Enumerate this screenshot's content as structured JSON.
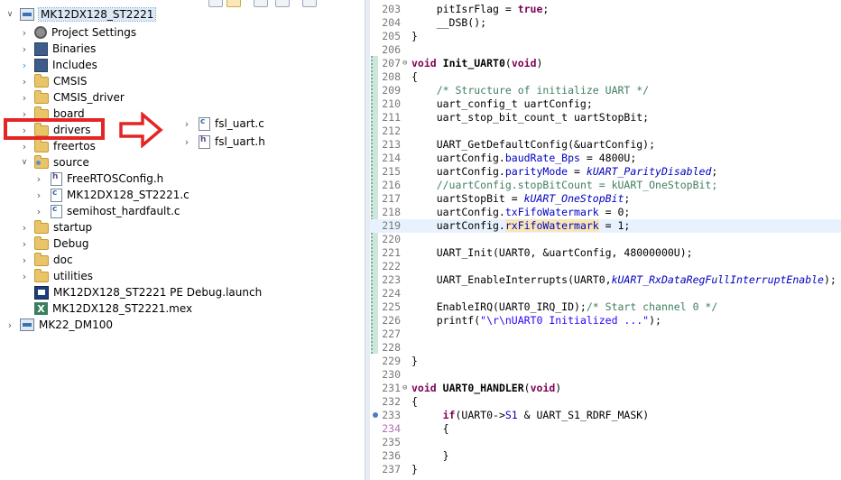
{
  "explorer": {
    "tree": [
      {
        "label": "MK12DX128_ST2221",
        "icon": "project-icon",
        "chevron": "down",
        "level": 0
      },
      {
        "label": "Project Settings",
        "icon": "gear-icon",
        "chevron": "right",
        "level": 1
      },
      {
        "label": "Binaries",
        "icon": "binaries-icon",
        "chevron": "right",
        "level": 1
      },
      {
        "label": "Includes",
        "icon": "includes-icon",
        "chevron": "right",
        "level": 1
      },
      {
        "label": "CMSIS",
        "icon": "folder-icon",
        "chevron": "right",
        "level": 1
      },
      {
        "label": "CMSIS_driver",
        "icon": "folder-icon",
        "chevron": "right",
        "level": 1
      },
      {
        "label": "board",
        "icon": "folder-icon",
        "chevron": "right",
        "level": 1
      },
      {
        "label": "drivers",
        "icon": "folder-icon",
        "chevron": "right",
        "level": 1
      },
      {
        "label": "freertos",
        "icon": "folder-icon",
        "chevron": "right",
        "level": 1
      },
      {
        "label": "source",
        "icon": "source-folder-icon",
        "chevron": "down",
        "level": 1
      },
      {
        "label": "FreeRTOSConfig.h",
        "icon": "header-file-icon",
        "chevron": "right",
        "level": 2
      },
      {
        "label": "MK12DX128_ST2221.c",
        "icon": "c-file-icon",
        "chevron": "right",
        "level": 2
      },
      {
        "label": "semihost_hardfault.c",
        "icon": "c-file-icon",
        "chevron": "right",
        "level": 2
      },
      {
        "label": "startup",
        "icon": "folder-icon",
        "chevron": "right",
        "level": 1
      },
      {
        "label": "Debug",
        "icon": "folder-icon",
        "chevron": "right",
        "level": 1
      },
      {
        "label": "doc",
        "icon": "folder-icon",
        "chevron": "right",
        "level": 1
      },
      {
        "label": "utilities",
        "icon": "folder-icon",
        "chevron": "right",
        "level": 1
      },
      {
        "label": "MK12DX128_ST2221 PE Debug.launch",
        "icon": "launch-icon",
        "chevron": "none",
        "level": 1
      },
      {
        "label": "MK12DX128_ST2221.mex",
        "icon": "mex-icon",
        "chevron": "none",
        "level": 1
      },
      {
        "label": "MK22_DM100",
        "icon": "project-icon",
        "chevron": "right",
        "level": 0
      }
    ],
    "overlay_files": [
      {
        "label": "fsl_uart.c",
        "icon": "c-file-icon"
      },
      {
        "label": "fsl_uart.h",
        "icon": "header-file-icon"
      }
    ],
    "mex_letter": "X",
    "h_letter": "h",
    "c_letter": "c"
  },
  "annotation": {
    "box_color": "#e52525",
    "arrow_color": "#e52525"
  },
  "editor": {
    "lines": [
      {
        "n": "203",
        "code": "    pitIsrFlag = true;"
      },
      {
        "n": "204",
        "code": "    __DSB();"
      },
      {
        "n": "205",
        "code": "}"
      },
      {
        "n": "206",
        "code": ""
      },
      {
        "n": "207",
        "code": "void Init_UART0(void)",
        "fold": true
      },
      {
        "n": "208",
        "code": "{"
      },
      {
        "n": "209",
        "code": "    /* Structure of initialize UART */"
      },
      {
        "n": "210",
        "code": "    uart_config_t uartConfig;"
      },
      {
        "n": "211",
        "code": "    uart_stop_bit_count_t uartStopBit;"
      },
      {
        "n": "212",
        "code": ""
      },
      {
        "n": "213",
        "code": "    UART_GetDefaultConfig(&uartConfig);"
      },
      {
        "n": "214",
        "code": "    uartConfig.baudRate_Bps = 4800U;"
      },
      {
        "n": "215",
        "code": "    uartConfig.parityMode = kUART_ParityDisabled;"
      },
      {
        "n": "216",
        "code": "    //uartConfig.stopBitCount = kUART_OneStopBit;"
      },
      {
        "n": "217",
        "code": "    uartStopBit = kUART_OneStopBit;"
      },
      {
        "n": "218",
        "code": "    uartConfig.txFifoWatermark = 0;"
      },
      {
        "n": "219",
        "code": "    uartConfig.rxFifoWatermark = 1;"
      },
      {
        "n": "220",
        "code": ""
      },
      {
        "n": "221",
        "code": "    UART_Init(UART0, &uartConfig, 48000000U);"
      },
      {
        "n": "222",
        "code": ""
      },
      {
        "n": "223",
        "code": "    UART_EnableInterrupts(UART0,kUART_RxDataRegFullInterruptEnable);"
      },
      {
        "n": "224",
        "code": ""
      },
      {
        "n": "225",
        "code": "    EnableIRQ(UART0_IRQ_ID);/* Start channel 0 */"
      },
      {
        "n": "226",
        "code": "    printf(\"\\r\\nUART0 Initialized ...\");"
      },
      {
        "n": "227",
        "code": ""
      },
      {
        "n": "228",
        "code": ""
      },
      {
        "n": "229",
        "code": "}"
      },
      {
        "n": "230",
        "code": ""
      },
      {
        "n": "231",
        "code": "void UART0_HANDLER(void)",
        "fold": true
      },
      {
        "n": "232",
        "code": "{"
      },
      {
        "n": "233",
        "code": "     if(UART0->S1 & UART_S1_RDRF_MASK)",
        "breakpoint": true
      },
      {
        "n": "234",
        "code": "     {"
      },
      {
        "n": "235",
        "code": ""
      },
      {
        "n": "236",
        "code": "     }"
      },
      {
        "n": "237",
        "code": "}"
      }
    ]
  }
}
